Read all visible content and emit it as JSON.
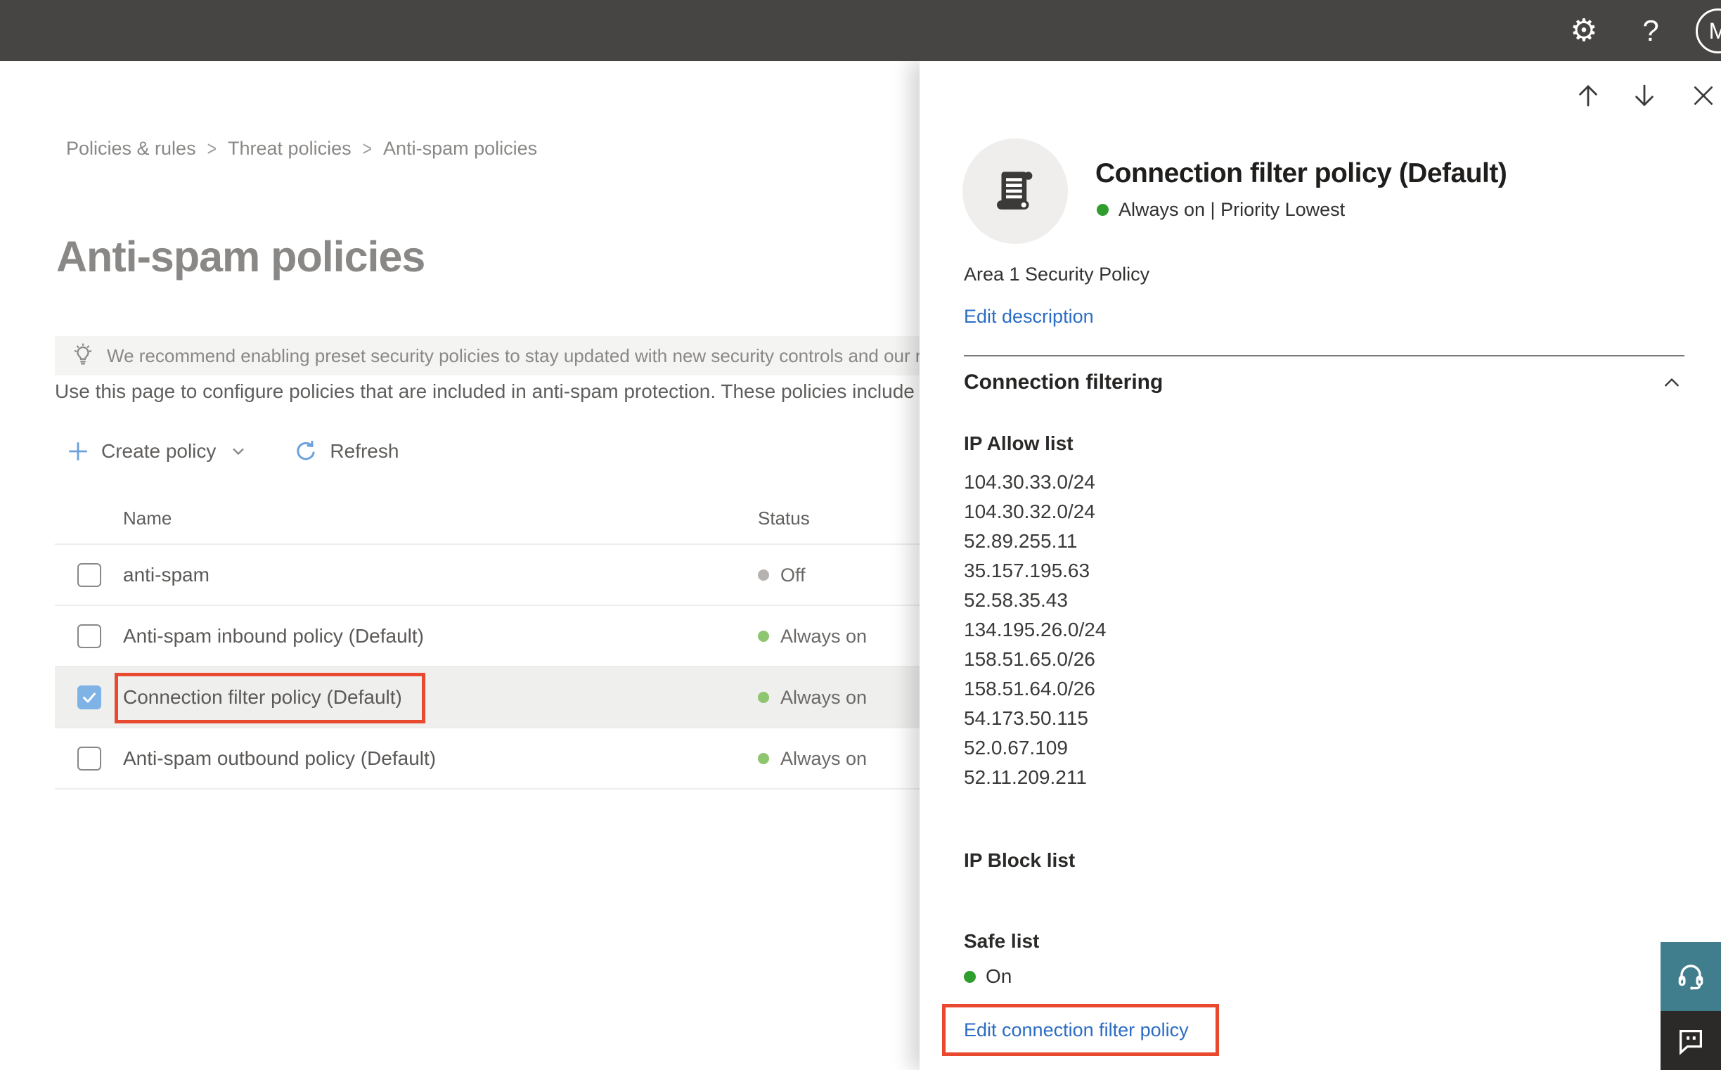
{
  "topbar": {
    "gear_glyph": "⚙",
    "help_label": "?",
    "avatar_initial": "M"
  },
  "breadcrumb": {
    "items": [
      "Policies & rules",
      "Threat policies",
      "Anti-spam policies"
    ],
    "separator": ">"
  },
  "page": {
    "title": "Anti-spam policies",
    "banner_text": "We recommend enabling preset security policies to stay updated with new security controls and our recomme",
    "description": "Use this page to configure policies that are included in anti-spam protection. These policies include"
  },
  "toolbar": {
    "create_label": "Create policy",
    "refresh_label": "Refresh"
  },
  "table": {
    "columns": [
      "Name",
      "Status"
    ],
    "rows": [
      {
        "name": "anti-spam",
        "status": "Off",
        "status_color": "gray",
        "checked": false,
        "highlighted": false,
        "outlined": false
      },
      {
        "name": "Anti-spam inbound policy (Default)",
        "status": "Always on",
        "status_color": "green",
        "checked": false,
        "highlighted": false,
        "outlined": false
      },
      {
        "name": "Connection filter policy (Default)",
        "status": "Always on",
        "status_color": "green",
        "checked": true,
        "highlighted": true,
        "outlined": true
      },
      {
        "name": "Anti-spam outbound policy (Default)",
        "status": "Always on",
        "status_color": "green",
        "checked": false,
        "highlighted": false,
        "outlined": false
      }
    ]
  },
  "panel": {
    "title": "Connection filter policy (Default)",
    "status_text": "Always on | Priority Lowest",
    "description": "Area 1 Security Policy",
    "edit_description_label": "Edit description",
    "section_title": "Connection filtering",
    "ip_allow_label": "IP Allow list",
    "ip_allow_items": [
      "104.30.33.0/24",
      "104.30.32.0/24",
      "52.89.255.11",
      "35.157.195.63",
      "52.58.35.43",
      "134.195.26.0/24",
      "158.51.65.0/26",
      "158.51.64.0/26",
      "54.173.50.115",
      "52.0.67.109",
      "52.11.209.211"
    ],
    "ip_block_label": "IP Block list",
    "safe_list_label": "Safe list",
    "safe_list_status": "On",
    "edit_policy_label": "Edit connection filter policy"
  },
  "colors": {
    "accent_blue": "#6ba1dc",
    "link_blue": "#2b6cc4",
    "checkbox_blue": "#7fb2e5",
    "status_green": "#8dc571",
    "status_green_bright": "#2f9e2f",
    "status_gray": "#b5b2b0",
    "highlight_red": "#e8492f",
    "support_teal": "#417e8d",
    "topbar_bg": "#474543"
  }
}
